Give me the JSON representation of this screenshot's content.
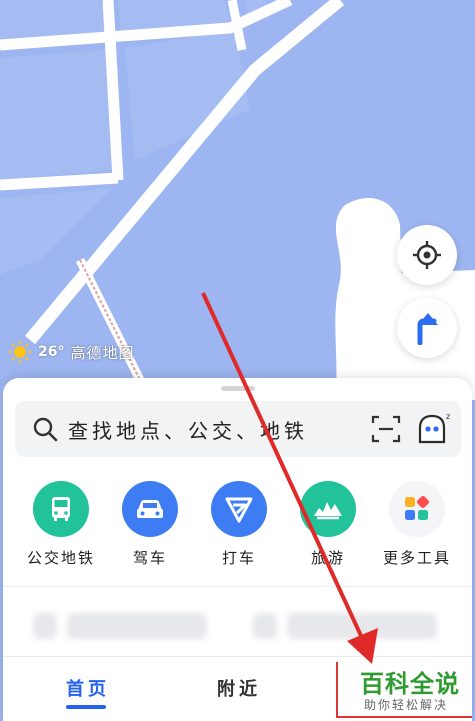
{
  "map": {
    "weather_temp": "26°",
    "brand": "高德地图",
    "locate_icon": "crosshair-icon",
    "compass_icon": "navigation-arrow-icon"
  },
  "search": {
    "placeholder": "查找地点、公交、地铁",
    "scan_icon": "scan-icon",
    "assistant_icon": "assistant-icon"
  },
  "quick_actions": [
    {
      "label": "公交地铁",
      "icon": "bus-icon",
      "color": "#22c39a"
    },
    {
      "label": "驾车",
      "icon": "car-icon",
      "color": "#3d7cf2"
    },
    {
      "label": "打车",
      "icon": "taxi-icon",
      "color": "#3d7cf2"
    },
    {
      "label": "旅游",
      "icon": "travel-icon",
      "color": "#22c39a"
    },
    {
      "label": "更多工具",
      "icon": "grid-icon",
      "color": "#f5f5f7"
    }
  ],
  "tabs": {
    "home": "首页",
    "nearby": "附近"
  },
  "watermark": {
    "title": "百科全说",
    "subtitle": "助你轻松解决"
  },
  "colors": {
    "accent": "#2463ef",
    "map_water": "#9db5f0",
    "arrow": "#e02a2a"
  }
}
